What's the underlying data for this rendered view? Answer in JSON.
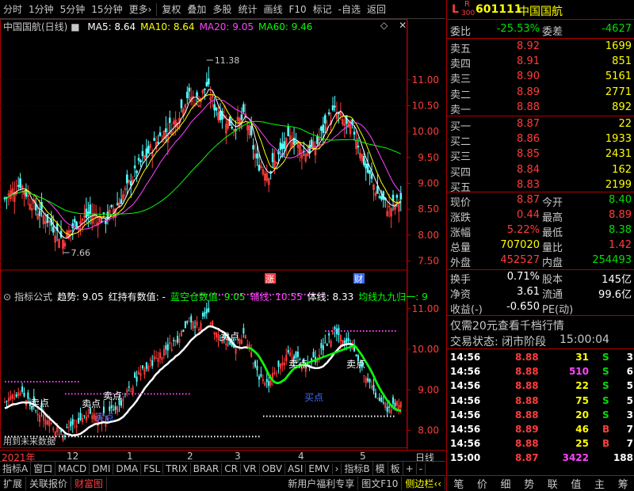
{
  "toolbar": {
    "items": [
      "分时",
      "1分钟",
      "5分钟",
      "15分钟",
      "更多›",
      "复权",
      "叠加",
      "多股",
      "统计",
      "画线",
      "F10",
      "标记",
      "-自选",
      "返回"
    ]
  },
  "main_chart": {
    "title": "中国国航(日线)",
    "ma": [
      {
        "label": "MA5: 8.64",
        "color": "#ffffff"
      },
      {
        "label": "MA10: 8.64",
        "color": "#ffff00"
      },
      {
        "label": "MA20: 9.05",
        "color": "#ff44ff"
      },
      {
        "label": "MA60: 9.46",
        "color": "#00ff00"
      }
    ],
    "price_ticks": [
      "11.00",
      "10.50",
      "10.00",
      "9.50",
      "9.00",
      "8.50",
      "8.00",
      "7.50"
    ],
    "high_label": "11.38",
    "low_label": "7.66",
    "markers": [
      "涨",
      "财"
    ]
  },
  "indicator": {
    "header": [
      {
        "text": "指标公式",
        "color": "#c8c8c8"
      },
      {
        "text": "趋势: 9.05",
        "color": "#ffffff"
      },
      {
        "text": "红持有数值: -",
        "color": "#ffffff"
      },
      {
        "text": "蓝空仓数值: 9.05",
        "color": "#00ff00"
      },
      {
        "text": "辅线: 10.55",
        "color": "#ff44ff"
      },
      {
        "text": "体线: 8.33",
        "color": "#ffffff"
      },
      {
        "text": "均线九九归一: 9",
        "color": "#00ff00"
      }
    ],
    "ticks": [
      "11.00",
      "10.00",
      "9.00",
      "8.00"
    ],
    "sell_labels": [
      "卖点",
      "卖点",
      "卖点",
      "卖点",
      "卖点",
      "卖点",
      "卖点"
    ],
    "buy_labels": [
      "买点",
      "买点"
    ],
    "future_note": "用到未来数据"
  },
  "timeline": {
    "labels": [
      "2021年",
      "12",
      "1",
      "2",
      "3",
      "4",
      "5"
    ],
    "period": "日线"
  },
  "bottom_tabs": [
    "指标A",
    "窗口",
    "MACD",
    "DMI",
    "DMA",
    "FSL",
    "TRIX",
    "BRAR",
    "CR",
    "VR",
    "OBV",
    "ASI",
    "EMV",
    "›",
    "指标B",
    "模",
    "板",
    "+",
    "-"
  ],
  "status_tabs": [
    "扩展",
    "关联报价",
    "财富图"
  ],
  "status_right": [
    "新用户福利专享",
    "图文F10",
    "侧边栏‹‹"
  ],
  "stock": {
    "code": "601111",
    "name": "中国国航",
    "tag_l": "L",
    "tag_r": "R",
    "tag_num": "300"
  },
  "order_book": {
    "ratio_label": "委比",
    "ratio_value": "-25.53%",
    "diff_label": "委差",
    "diff_value": "-4627",
    "asks": [
      {
        "label": "卖五",
        "price": "8.92",
        "vol": "1699"
      },
      {
        "label": "卖四",
        "price": "8.91",
        "vol": "851"
      },
      {
        "label": "卖三",
        "price": "8.90",
        "vol": "5161"
      },
      {
        "label": "卖二",
        "price": "8.89",
        "vol": "2771"
      },
      {
        "label": "卖一",
        "price": "8.88",
        "vol": "892"
      }
    ],
    "bids": [
      {
        "label": "买一",
        "price": "8.87",
        "vol": "22"
      },
      {
        "label": "买二",
        "price": "8.86",
        "vol": "1933"
      },
      {
        "label": "买三",
        "price": "8.85",
        "vol": "2431"
      },
      {
        "label": "买四",
        "price": "8.84",
        "vol": "162"
      },
      {
        "label": "买五",
        "price": "8.83",
        "vol": "2199"
      }
    ]
  },
  "quote": [
    {
      "l1": "现价",
      "v1": "8.87",
      "c1": "#ff3c3c",
      "l2": "今开",
      "v2": "8.40",
      "c2": "#00e000"
    },
    {
      "l1": "涨跌",
      "v1": "0.44",
      "c1": "#ff3c3c",
      "l2": "最高",
      "v2": "8.89",
      "c2": "#ff3c3c"
    },
    {
      "l1": "涨幅",
      "v1": "5.22%",
      "c1": "#ff3c3c",
      "l2": "最低",
      "v2": "8.38",
      "c2": "#00e000"
    },
    {
      "l1": "总量",
      "v1": "707020",
      "c1": "#ffff00",
      "l2": "量比",
      "v2": "1.42",
      "c2": "#ff3c3c"
    },
    {
      "l1": "外盘",
      "v1": "452527",
      "c1": "#ff3c3c",
      "l2": "内盘",
      "v2": "254493",
      "c2": "#00e000"
    }
  ],
  "quote2": [
    {
      "l1": "换手",
      "v1": "0.71%",
      "l2": "股本",
      "v2": "145亿"
    },
    {
      "l1": "净资",
      "v1": "3.61",
      "l2": "流通",
      "v2": "99.6亿"
    },
    {
      "l1": "收益(-)",
      "v1": "-0.650",
      "l2": "PE(动)",
      "v2": ""
    }
  ],
  "promo": "仅需20元查看千档行情",
  "trade_status": {
    "label": "交易状态: 闭市阶段",
    "time": "15:00:04"
  },
  "ticks": [
    {
      "time": "14:56",
      "price": "8.88",
      "vol": "31",
      "vc": "#ffff00",
      "side": "S",
      "sc": "#00e000",
      "n": "3"
    },
    {
      "time": "14:56",
      "price": "8.88",
      "vol": "510",
      "vc": "#ff44ff",
      "side": "S",
      "sc": "#00e000",
      "n": "6"
    },
    {
      "time": "14:56",
      "price": "8.88",
      "vol": "22",
      "vc": "#ffff00",
      "side": "S",
      "sc": "#00e000",
      "n": "5"
    },
    {
      "time": "14:56",
      "price": "8.88",
      "vol": "75",
      "vc": "#ffff00",
      "side": "S",
      "sc": "#00e000",
      "n": "5"
    },
    {
      "time": "14:56",
      "price": "8.88",
      "vol": "20",
      "vc": "#ffff00",
      "side": "S",
      "sc": "#00e000",
      "n": "3"
    },
    {
      "time": "14:56",
      "price": "8.89",
      "vol": "46",
      "vc": "#ffff00",
      "side": "B",
      "sc": "#ff3c3c",
      "n": "7"
    },
    {
      "time": "14:56",
      "price": "8.88",
      "vol": "25",
      "vc": "#ffff00",
      "side": "B",
      "sc": "#ff3c3c",
      "n": "7"
    },
    {
      "time": "15:00",
      "price": "8.87",
      "vol": "3422",
      "vc": "#ff44ff",
      "side": "",
      "sc": "#ffffff",
      "n": "188"
    }
  ],
  "nav": [
    "笔",
    "价",
    "细",
    "势",
    "联",
    "值",
    "主",
    "筹"
  ]
}
